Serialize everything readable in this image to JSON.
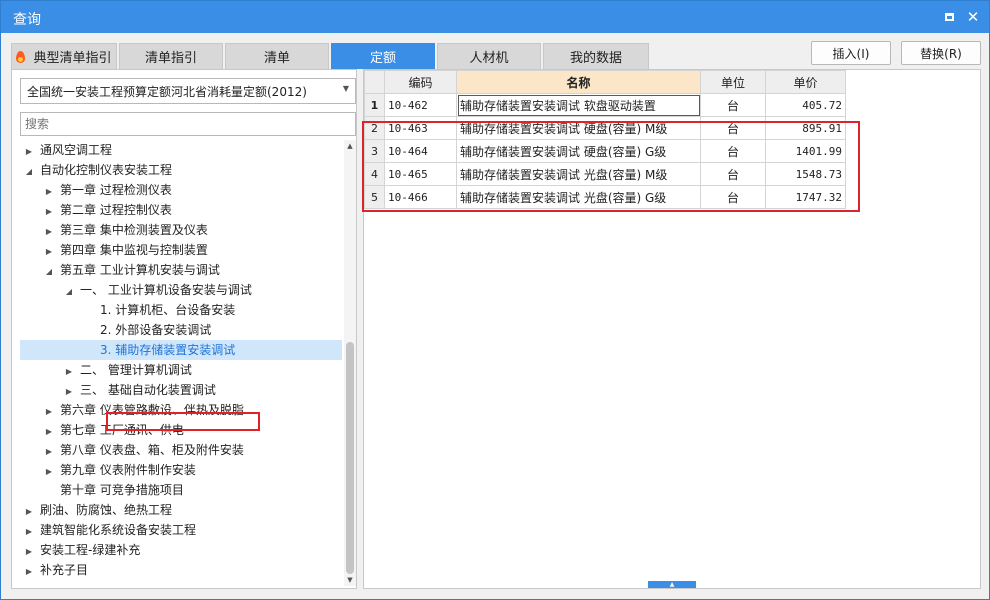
{
  "window": {
    "title": "查询"
  },
  "tabs": [
    {
      "label": "典型清单指引"
    },
    {
      "label": "清单指引"
    },
    {
      "label": "清单"
    },
    {
      "label": "定额"
    },
    {
      "label": "人材机"
    },
    {
      "label": "我的数据"
    }
  ],
  "actions": {
    "insert": "插入(I)",
    "replace": "替换(R)"
  },
  "left": {
    "select_value": "全国统一安装工程预算定额河北省消耗量定额(2012)",
    "search_placeholder": "搜索",
    "tree": [
      {
        "label": "通风空调工程",
        "expander": "collapsed",
        "depth": 0
      },
      {
        "label": "自动化控制仪表安装工程",
        "expander": "expanded",
        "depth": 0
      },
      {
        "label": "第一章 过程检测仪表",
        "expander": "collapsed",
        "depth": 1
      },
      {
        "label": "第二章 过程控制仪表",
        "expander": "collapsed",
        "depth": 1
      },
      {
        "label": "第三章 集中检测装置及仪表",
        "expander": "collapsed",
        "depth": 1
      },
      {
        "label": "第四章 集中监视与控制装置",
        "expander": "collapsed",
        "depth": 1
      },
      {
        "label": "第五章 工业计算机安装与调试",
        "expander": "expanded",
        "depth": 1
      },
      {
        "label": "一、 工业计算机设备安装与调试",
        "expander": "expanded",
        "depth": 2
      },
      {
        "label": "1. 计算机柜、台设备安装",
        "expander": "none",
        "depth": 3
      },
      {
        "label": "2. 外部设备安装调试",
        "expander": "none",
        "depth": 3
      },
      {
        "label": "3. 辅助存储装置安装调试",
        "expander": "none",
        "depth": 3,
        "selected": true
      },
      {
        "label": "二、 管理计算机调试",
        "expander": "collapsed",
        "depth": 2
      },
      {
        "label": "三、 基础自动化装置调试",
        "expander": "collapsed",
        "depth": 2
      },
      {
        "label": "第六章 仪表管路敷设、伴热及脱脂",
        "expander": "collapsed",
        "depth": 1
      },
      {
        "label": "第七章 工厂通讯、供电",
        "expander": "collapsed",
        "depth": 1
      },
      {
        "label": "第八章 仪表盘、箱、柜及附件安装",
        "expander": "collapsed",
        "depth": 1
      },
      {
        "label": "第九章 仪表附件制作安装",
        "expander": "collapsed",
        "depth": 1
      },
      {
        "label": "第十章 可竞争措施项目",
        "expander": "none",
        "depth": 1
      },
      {
        "label": "刷油、防腐蚀、绝热工程",
        "expander": "collapsed",
        "depth": 0
      },
      {
        "label": "建筑智能化系统设备安装工程",
        "expander": "collapsed",
        "depth": 0
      },
      {
        "label": "安装工程-绿建补充",
        "expander": "collapsed",
        "depth": 0
      },
      {
        "label": "补充子目",
        "expander": "collapsed",
        "depth": 0
      }
    ]
  },
  "table": {
    "headers": {
      "code": "编码",
      "name": "名称",
      "unit": "单位",
      "price": "单价"
    },
    "rows": [
      {
        "num": "1",
        "code": "10-462",
        "name": "辅助存储装置安装调试 软盘驱动装置",
        "unit": "台",
        "price": "405.72"
      },
      {
        "num": "2",
        "code": "10-463",
        "name": "辅助存储装置安装调试 硬盘(容量) M级",
        "unit": "台",
        "price": "895.91"
      },
      {
        "num": "3",
        "code": "10-464",
        "name": "辅助存储装置安装调试 硬盘(容量) G级",
        "unit": "台",
        "price": "1401.99"
      },
      {
        "num": "4",
        "code": "10-465",
        "name": "辅助存储装置安装调试 光盘(容量) M级",
        "unit": "台",
        "price": "1548.73"
      },
      {
        "num": "5",
        "code": "10-466",
        "name": "辅助存储装置安装调试 光盘(容量) G级",
        "unit": "台",
        "price": "1747.32"
      }
    ]
  },
  "colors": {
    "accent": "#3a8ee6",
    "highlight_border": "#d9262e",
    "header_highlight": "#fbe6c8",
    "selected_row": "#cfe6fb"
  },
  "icons": {
    "restore": "restore-icon",
    "close": "close-icon",
    "tab_fire": "fire-icon"
  }
}
